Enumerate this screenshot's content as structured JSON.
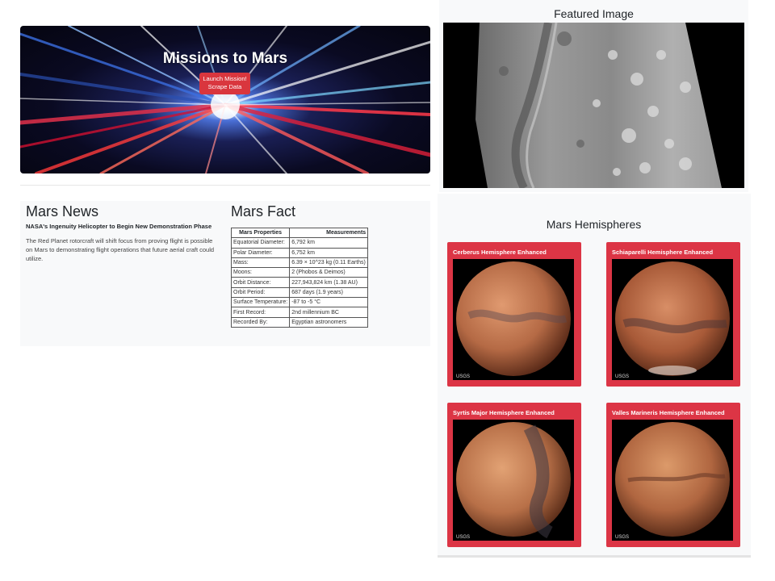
{
  "hero": {
    "title": "Missions to Mars",
    "button_line1": "Launch Mission!",
    "button_line2": "Scrape Data"
  },
  "news": {
    "section_title": "Mars News",
    "headline": "NASA's Ingenuity Helicopter to Begin New Demonstration Phase",
    "body": "The Red Planet rotorcraft will shift focus from proving flight is possible on Mars to demonstrating flight operations that future aerial craft could utilize."
  },
  "facts": {
    "section_title": "Mars Fact",
    "headers": [
      "Mars Properties",
      "Measurements"
    ],
    "rows": [
      [
        "Equatorial Diameter:",
        "6,792 km"
      ],
      [
        "Polar Diameter:",
        "6,752 km"
      ],
      [
        "Mass:",
        "6.39 × 10^23 kg (0.11 Earths)"
      ],
      [
        "Moons:",
        "2 (Phobos & Deimos)"
      ],
      [
        "Orbit Distance:",
        "227,943,824 km (1.38 AU)"
      ],
      [
        "Orbit Period:",
        "687 days (1.9 years)"
      ],
      [
        "Surface Temperature:",
        "-87 to -5 °C"
      ],
      [
        "First Record:",
        "2nd millennium BC"
      ],
      [
        "Recorded By:",
        "Egyptian astronomers"
      ]
    ]
  },
  "featured": {
    "title": "Featured Image"
  },
  "hemispheres": {
    "title": "Mars Hemispheres",
    "cards": [
      {
        "title": "Cerberus Hemisphere Enhanced",
        "tone": "#c07048"
      },
      {
        "title": "Schiaparelli Hemisphere Enhanced",
        "tone": "#b86440"
      },
      {
        "title": "Syrtis Major Hemisphere Enhanced",
        "tone": "#c27850"
      },
      {
        "title": "Valles Marineris Hemisphere Enhanced",
        "tone": "#b8683e"
      }
    ],
    "logo_text": "USGS"
  },
  "colors": {
    "accent_red": "#dc3545",
    "panel_bg": "#f8f9fa"
  }
}
